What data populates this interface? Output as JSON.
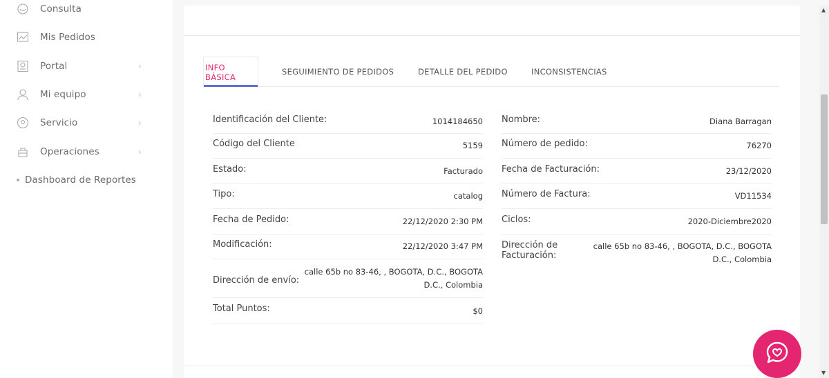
{
  "sidebar": {
    "items": [
      {
        "label": "Consulta",
        "icon": "consult-icon",
        "has_chevron": false
      },
      {
        "label": "Mis Pedidos",
        "icon": "chart-icon",
        "has_chevron": false
      },
      {
        "label": "Portal",
        "icon": "portal-icon",
        "has_chevron": true
      },
      {
        "label": "Mi equipo",
        "icon": "team-icon",
        "has_chevron": true
      },
      {
        "label": "Servicio",
        "icon": "service-icon",
        "has_chevron": true
      },
      {
        "label": "Operaciones",
        "icon": "operations-icon",
        "has_chevron": true
      }
    ],
    "subitem": "Dashboard de Reportes",
    "chevron": "›"
  },
  "tabs": [
    {
      "label": "INFO BÁSICA",
      "active": true
    },
    {
      "label": "SEGUIMIENTO DE PEDIDOS",
      "active": false
    },
    {
      "label": "DETALLE DEL PEDIDO",
      "active": false
    },
    {
      "label": "INCONSISTENCIAS",
      "active": false
    }
  ],
  "left_fields": [
    {
      "label": "Identificación del Cliente:",
      "value": "1014184650"
    },
    {
      "label": "Código del Cliente",
      "value": "5159"
    },
    {
      "label": "Estado:",
      "value": "Facturado"
    },
    {
      "label": "Tipo:",
      "value": "catalog"
    },
    {
      "label": "Fecha de Pedido:",
      "value": "22/12/2020 2:30 PM"
    },
    {
      "label": "Modificación:",
      "value": "22/12/2020 3:47 PM"
    },
    {
      "label": "Dirección de envío:",
      "value": "calle 65b no 83-46, , BOGOTA, D.C., BOGOTA D.C., Colombia"
    },
    {
      "label": "Total Puntos:",
      "value": "$0"
    }
  ],
  "right_fields": [
    {
      "label": "Nombre:",
      "value": "Diana Barragan"
    },
    {
      "label": "Número de pedido:",
      "value": "76270"
    },
    {
      "label": "Fecha de Facturación:",
      "value": "23/12/2020"
    },
    {
      "label": "Número de Factura:",
      "value": "VD11534"
    },
    {
      "label": "Ciclos:",
      "value": "2020-Diciembre2020"
    },
    {
      "label": "Dirección de Facturación:",
      "value": "calle 65b no 83-46, , BOGOTA, D.C., BOGOTA D.C., Colombia"
    }
  ],
  "colors": {
    "accent": "#e3266f",
    "tab_underline": "#5b6ed6"
  },
  "chat_button": {
    "icon": "chat-heart-icon"
  }
}
